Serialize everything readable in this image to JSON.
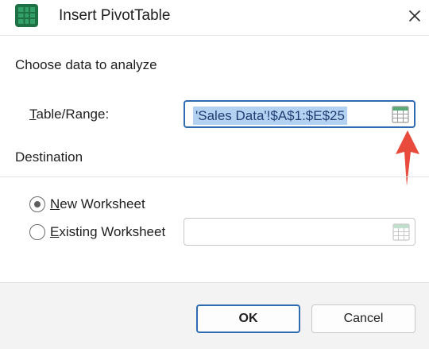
{
  "dialog": {
    "title": "Insert PivotTable",
    "app_icon": "excel-grid-icon",
    "close_icon": "close-icon"
  },
  "source_section": {
    "heading": "Choose data to analyze",
    "field_label_underlined": "T",
    "field_label_rest": "able/Range:",
    "range_value": "'Sales Data'!$A$1:$E$25",
    "range_picker_icon": "range-select-icon"
  },
  "destination_section": {
    "heading": "Destination",
    "options": [
      {
        "underlined": "N",
        "rest": "ew Worksheet",
        "checked": true
      },
      {
        "underlined": "E",
        "rest": "xisting Worksheet",
        "checked": false
      }
    ],
    "location_value": "",
    "location_picker_icon": "range-select-icon"
  },
  "buttons": {
    "ok": "OK",
    "cancel": "Cancel"
  },
  "annotation": {
    "icon": "red-up-arrow-icon",
    "color": "#e84b3c"
  },
  "colors": {
    "accent": "#2e6bb0",
    "selection": "#b3d1f0",
    "excel_green": "#1e7145"
  }
}
